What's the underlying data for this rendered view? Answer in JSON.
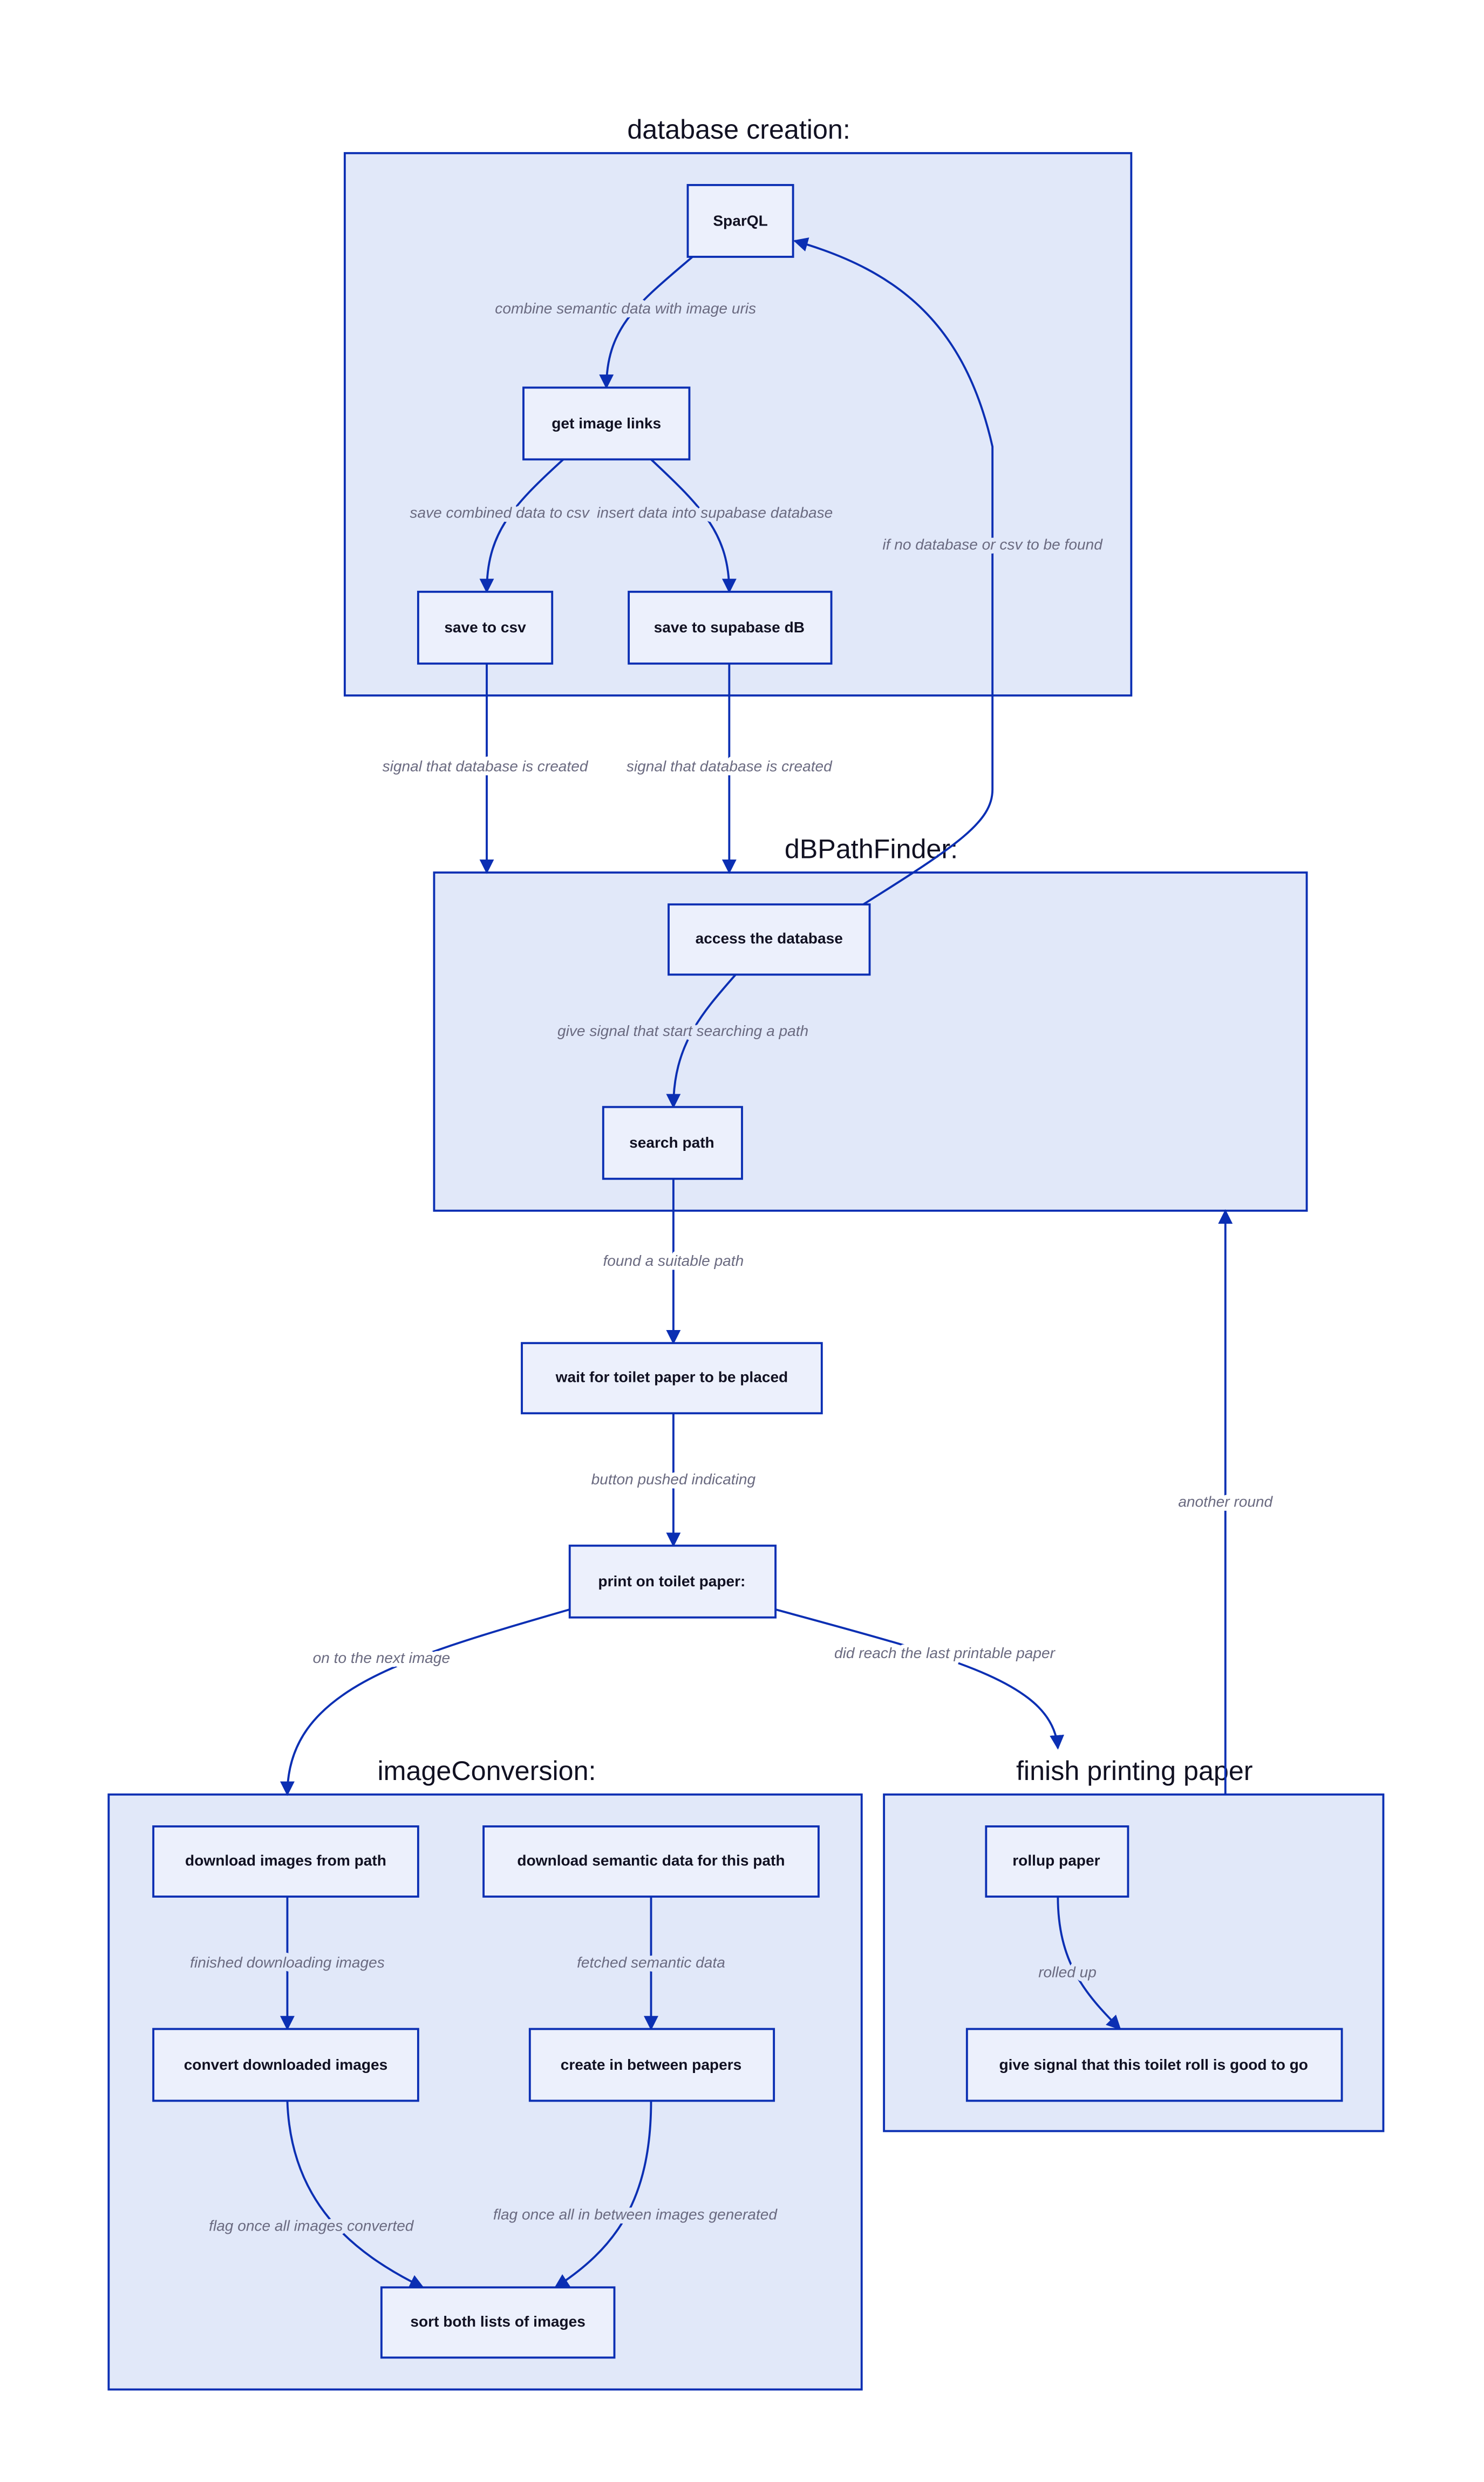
{
  "colors": {
    "cluster_fill": "#e1e8f9",
    "node_fill": "#ecf0fc",
    "stroke": "#0b2fb3",
    "label_text": "#6a6a80"
  },
  "clusters": {
    "database_creation": "database creation:",
    "dbpathfinder": "dBPathFinder:",
    "image_conversion": "imageConversion:",
    "finish_printing": "finish printing paper"
  },
  "nodes": {
    "sparql": "SparQL",
    "get_image_links": "get image links",
    "save_csv": "save to csv",
    "save_supabase": "save to supabase dB",
    "access_db": "access the database",
    "search_path": "search path",
    "wait_paper": "wait for toilet paper to be placed",
    "print_paper": "print on toilet paper:",
    "download_images": "download images from path",
    "download_semantic": "download semantic data for this path",
    "convert_images": "convert downloaded images",
    "create_between": "create in between papers",
    "sort_lists": "sort both lists of images",
    "rollup": "rollup paper",
    "give_signal": "give signal that this toilet roll is good to go"
  },
  "edges": {
    "combine": "combine semantic data with image uris",
    "save_combined": "save combined data to csv",
    "insert_data": "insert data into supabase database",
    "signal_csv": "signal that database is created",
    "signal_supabase": "signal that database is created",
    "no_database": "if no database or csv to be found",
    "start_search": "give signal that start searching a path",
    "found_path": "found a suitable path",
    "button_pushed": "button pushed indicating",
    "next_image": "on to the next image",
    "last_paper": "did reach the last printable paper",
    "another_round": "another round",
    "finished_download": "finished downloading images",
    "fetched_semantic": "fetched semantic data",
    "flag_converted": "flag once all images converted",
    "flag_generated": "flag once all in between images generated",
    "rolled_up": "rolled up"
  }
}
